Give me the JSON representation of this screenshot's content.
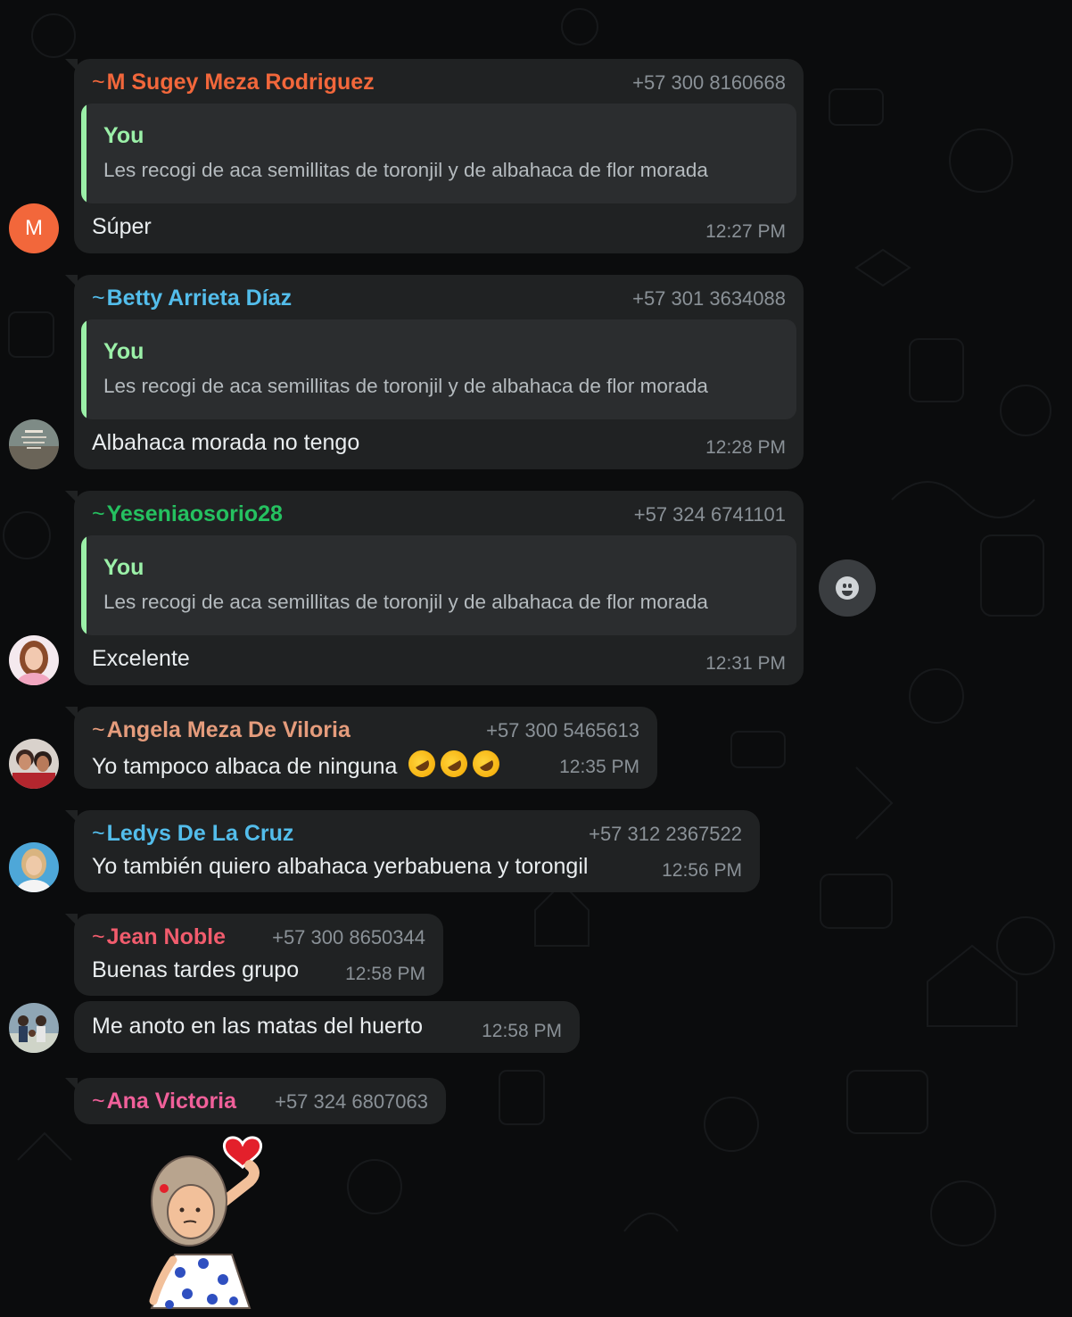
{
  "colors": {
    "background": "#0b0c0d",
    "bubble": "#202223",
    "quote_bg": "#2b2d2f",
    "quote_accent": "#9bf0a8",
    "time": "#8a9197",
    "text": "#e9edef"
  },
  "messages": [
    {
      "sender_prefix": "~",
      "sender": "M Sugey Meza Rodriguez",
      "sender_color": "#f2673b",
      "phone": "+57 300 8160668",
      "quote": {
        "author": "You",
        "text": "Les recogi de aca semillitas de toronjil y de albahaca de flor morada"
      },
      "text": "Súper",
      "time": "12:27 PM",
      "avatar_letter": "M"
    },
    {
      "sender_prefix": "~",
      "sender": "Betty Arrieta Díaz",
      "sender_color": "#53bdeb",
      "phone": "+57 301 3634088",
      "quote": {
        "author": "You",
        "text": "Les recogi de aca semillitas de toronjil y de albahaca de flor morada"
      },
      "text": "Albahaca morada no tengo",
      "time": "12:28 PM"
    },
    {
      "sender_prefix": "~",
      "sender": "Yeseniaosorio28",
      "sender_color": "#25c160",
      "phone": "+57 324 6741101",
      "quote": {
        "author": "You",
        "text": "Les recogi de aca semillitas de toronjil y de albahaca de flor morada"
      },
      "text": "Excelente",
      "time": "12:31 PM"
    },
    {
      "sender_prefix": "~",
      "sender": "Angela Meza De Viloria",
      "sender_color": "#e59c7c",
      "phone": "+57 300 5465613",
      "text": "Yo tampoco albaca de ninguna",
      "emoji": "rolling-on-floor-laughing x3",
      "time": "12:35 PM"
    },
    {
      "sender_prefix": "~",
      "sender": "Ledys De La Cruz",
      "sender_color": "#53bdeb",
      "phone": "+57 312 2367522",
      "text": "Yo también quiero albahaca yerbabuena y torongil",
      "time": "12:56 PM"
    },
    {
      "sender_prefix": "~",
      "sender": "Jean Noble",
      "sender_color": "#f15c6d",
      "phone": "+57 300 8650344",
      "text": "Buenas tardes grupo",
      "time": "12:58 PM",
      "followup": {
        "text": "Me anoto en las matas del huerto",
        "time": "12:58 PM"
      }
    },
    {
      "sender_prefix": "~",
      "sender": "Ana Victoria",
      "sender_color": "#f0609a",
      "phone": "+57 324 6807063",
      "sticker": "girl-holding-heart-sticker"
    }
  ],
  "icons": {
    "reaction": "emoji-reaction-icon"
  }
}
